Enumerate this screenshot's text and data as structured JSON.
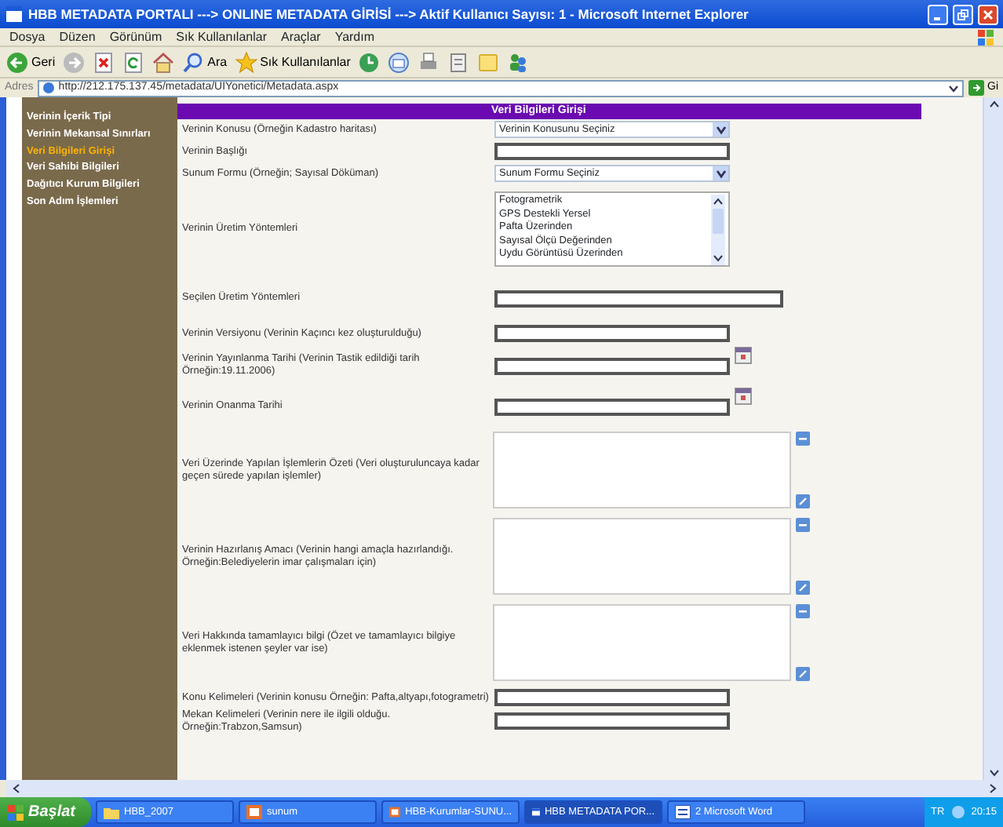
{
  "window": {
    "title": "HBB METADATA PORTALI ---> ONLINE METADATA GİRİSİ ---> Aktif Kullanıcı Sayısı: 1 - Microsoft Internet Explorer"
  },
  "menu": [
    "Dosya",
    "Düzen",
    "Görünüm",
    "Sık Kullanılanlar",
    "Araçlar",
    "Yardım"
  ],
  "toolbar": [
    {
      "kind": "back",
      "label": "Geri"
    },
    {
      "kind": "forward"
    },
    {
      "kind": "stop"
    },
    {
      "kind": "refresh"
    },
    {
      "kind": "home"
    },
    {
      "kind": "search",
      "label": "Ara"
    },
    {
      "kind": "favorites",
      "label": "Sık Kullanılanlar"
    },
    {
      "kind": "history"
    },
    {
      "kind": "mail"
    },
    {
      "kind": "print"
    },
    {
      "kind": "edit"
    },
    {
      "kind": "folder"
    },
    {
      "kind": "messenger"
    }
  ],
  "address": {
    "label": "Adres",
    "url": "http://212.175.137.45/metadata/UIYonetici/Metadata.aspx",
    "go": "Gi"
  },
  "sidebar": {
    "items": [
      {
        "label": "Verinin İçerik Tipi",
        "selected": false
      },
      {
        "label": "Verinin Mekansal Sınırları",
        "selected": false
      },
      {
        "label": "Veri Bilgileri Girişi",
        "selected": true
      },
      {
        "label": "Veri Sahibi Bilgileri",
        "selected": false
      },
      {
        "label": "Dağıtıcı Kurum Bilgileri",
        "selected": false
      },
      {
        "label": "Son Adım İşlemleri",
        "selected": false
      }
    ]
  },
  "form": {
    "title": "Veri Bilgileri Girişi",
    "fields": [
      {
        "kind": "select",
        "label": "Verinin Konusu (Örneğin Kadastro haritası)",
        "value": "Verinin Konusunu Seçiniz"
      },
      {
        "kind": "text",
        "label": "Verinin Başlığı"
      },
      {
        "kind": "select",
        "label": "Sunum Formu (Örneğin; Sayısal Döküman)",
        "value": "Sunum Formu Seçiniz"
      },
      {
        "kind": "listbox",
        "label": "Verinin Üretim Yöntemleri",
        "options": [
          "Fotogrametrik",
          "GPS Destekli Yersel",
          "Pafta Üzerinden",
          "Sayısal Ölçü Değerinden",
          "Uydu Görüntüsü Üzerinden"
        ]
      },
      {
        "kind": "wide",
        "label": "Seçilen Üretim Yöntemleri"
      },
      {
        "kind": "text",
        "label": "Verinin Versiyonu (Verinin Kaçıncı kez oluşturulduğu)"
      },
      {
        "kind": "date",
        "label": "Verinin Yayınlanma Tarihi (Verinin Tastik edildiği tarih Örneğin:19.11.2006)"
      },
      {
        "kind": "date",
        "label": "Verinin Onanma Tarihi"
      },
      {
        "kind": "textarea",
        "label": "Veri Üzerinde Yapılan İşlemlerin Özeti (Veri oluşturuluncaya kadar geçen sürede yapılan işlemler)"
      },
      {
        "kind": "textarea",
        "label": "Verinin Hazırlanış Amacı (Verinin hangi amaçla hazırlandığı. Örneğin:Belediyelerin imar çalışmaları için)"
      },
      {
        "kind": "textarea",
        "label": "Veri Hakkında tamamlayıcı bilgi (Özet ve tamamlayıcı bilgiye eklenmek istenen şeyler var ise)"
      },
      {
        "kind": "text",
        "label": "Konu Kelimeleri (Verinin konusu Örneğin: Pafta,altyapı,fotogrametri)"
      },
      {
        "kind": "text",
        "label": "Mekan Kelimeleri (Verinin nere ile ilgili olduğu. Örneğin:Trabzon,Samsun)"
      }
    ]
  },
  "taskbar": {
    "start": "Başlat",
    "tasks": [
      {
        "kind": "folder",
        "label": "HBB_2007",
        "selected": false
      },
      {
        "kind": "slides",
        "label": "sunum",
        "selected": false
      },
      {
        "kind": "slides",
        "label": "HBB-Kurumlar-SUNU...",
        "selected": false
      },
      {
        "kind": "browser",
        "label": "HBB METADATA POR...",
        "selected": true
      },
      {
        "kind": "word",
        "label": "2 Microsoft Word",
        "selected": false
      }
    ],
    "language": "TR",
    "clock": "20:15"
  }
}
